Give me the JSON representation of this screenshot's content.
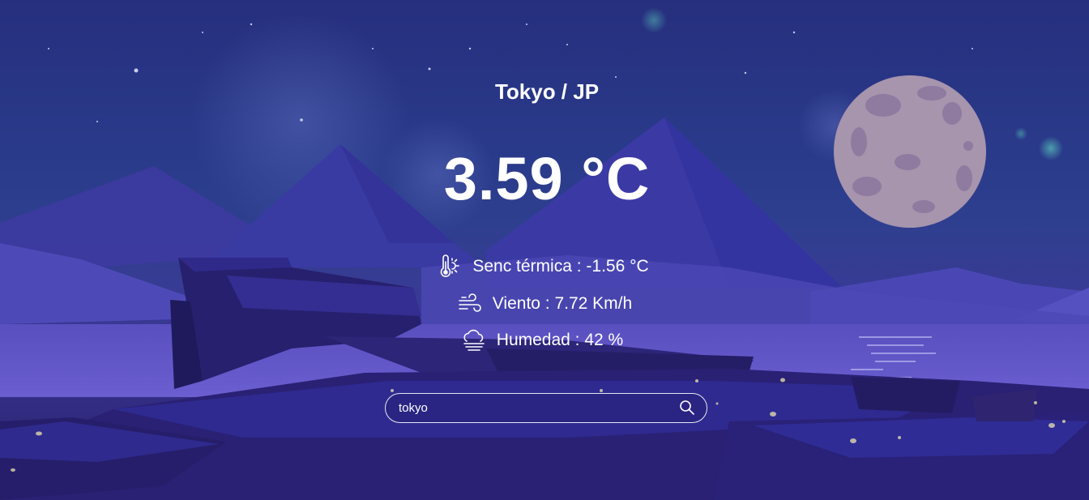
{
  "weather": {
    "location": "Tokyo / JP",
    "temperature": "3.59 °C",
    "feels_like": "Senc térmica : -1.56 °C",
    "wind": "Viento : 7.72 Km/h",
    "humidity": "Humedad : 42 %"
  },
  "search": {
    "value": "tokyo"
  },
  "icons": {
    "feels_like": "thermometer-sun-icon",
    "wind": "wind-icon",
    "humidity": "cloud-fog-icon",
    "search": "search-icon"
  },
  "colors": {
    "sky": "#262f7e",
    "moon": "#a794ad",
    "text": "#ffffff"
  }
}
